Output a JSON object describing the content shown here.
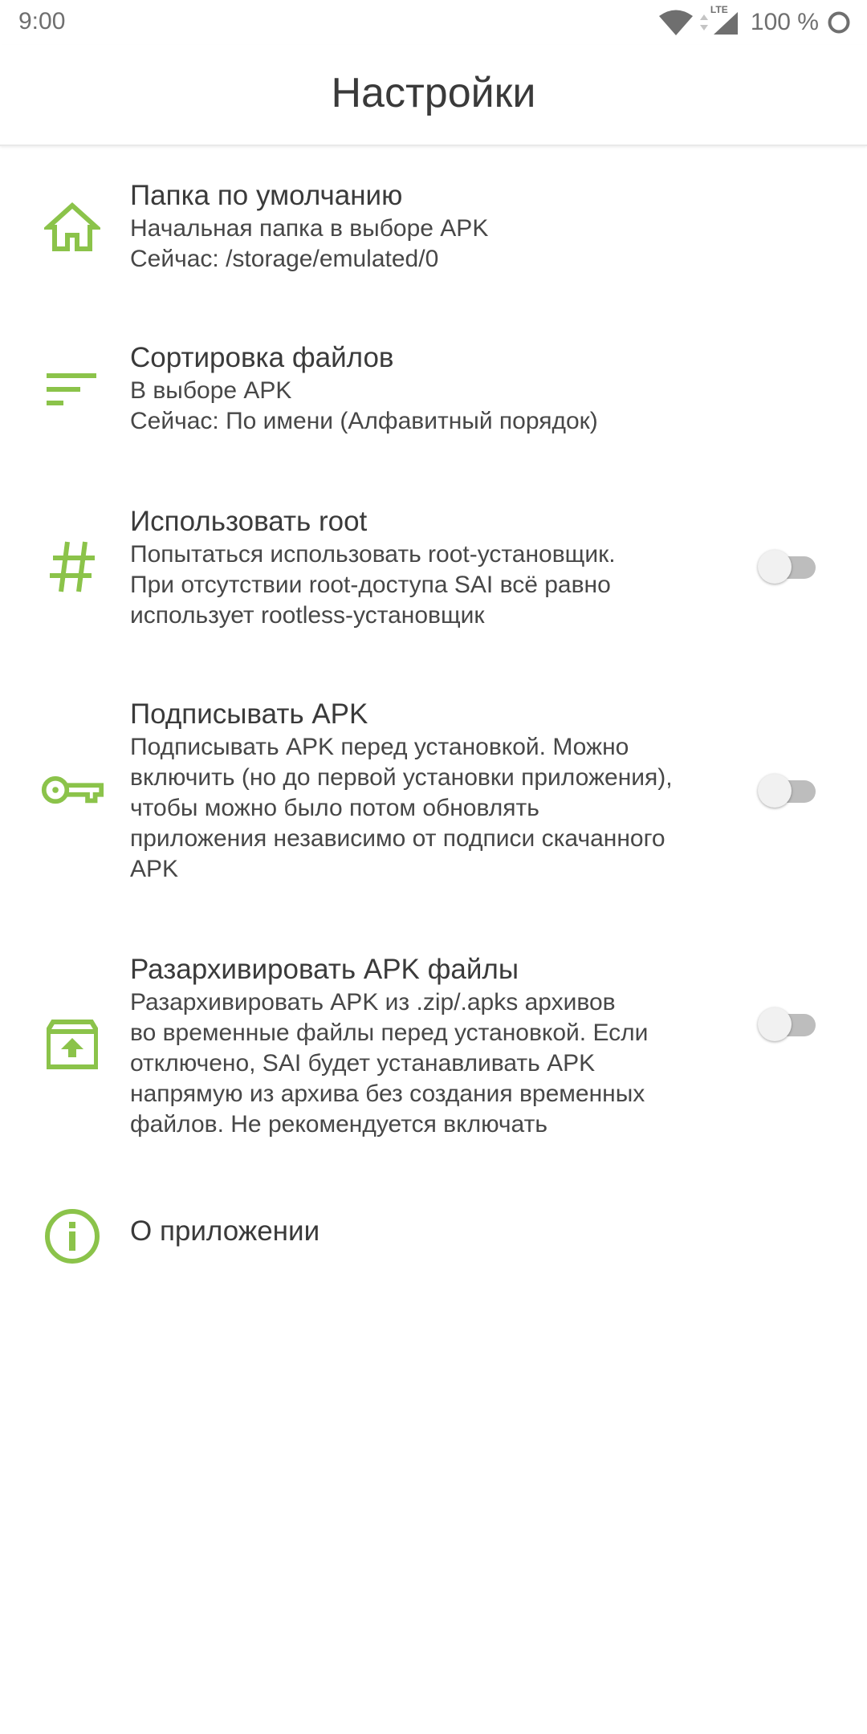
{
  "status_bar": {
    "time": "9:00",
    "network": "LTE",
    "battery": "100 %"
  },
  "app_bar": {
    "title": "Настройки"
  },
  "accent_color": "#8bc34a",
  "settings": [
    {
      "icon": "home-icon",
      "title": "Папка по умолчанию",
      "summary": "Начальная папка в выборе APK\nСейчас: /storage/emulated/0"
    },
    {
      "icon": "sort-icon",
      "title": "Сортировка файлов",
      "summary": "В выборе APK\nСейчас: По имени (Алфавитный порядок)"
    },
    {
      "icon": "hash-icon",
      "title": "Использовать root",
      "summary": "Попытаться использовать root-установщик.\nПри отсутствии root-доступа SAI всё равно\nиспользует rootless-установщик",
      "toggle": false
    },
    {
      "icon": "key-icon",
      "title": "Подписывать APK",
      "summary": "Подписывать APK перед установкой. Можно\nвключить (но до первой установки приложения),\nчтобы можно было потом обновлять\nприложения независимо от подписи скачанного\nAPK",
      "toggle": false
    },
    {
      "icon": "unarchive-icon",
      "title": "Разархивировать APK файлы",
      "summary": "Разархивировать APK из .zip/.apks архивов\nво временные файлы перед установкой. Если\nотключено, SAI будет устанавливать APK\nнапрямую из архива без создания временных\nфайлов. Не рекомендуется включать",
      "toggle": false
    },
    {
      "icon": "info-icon",
      "title": "О приложении"
    }
  ]
}
